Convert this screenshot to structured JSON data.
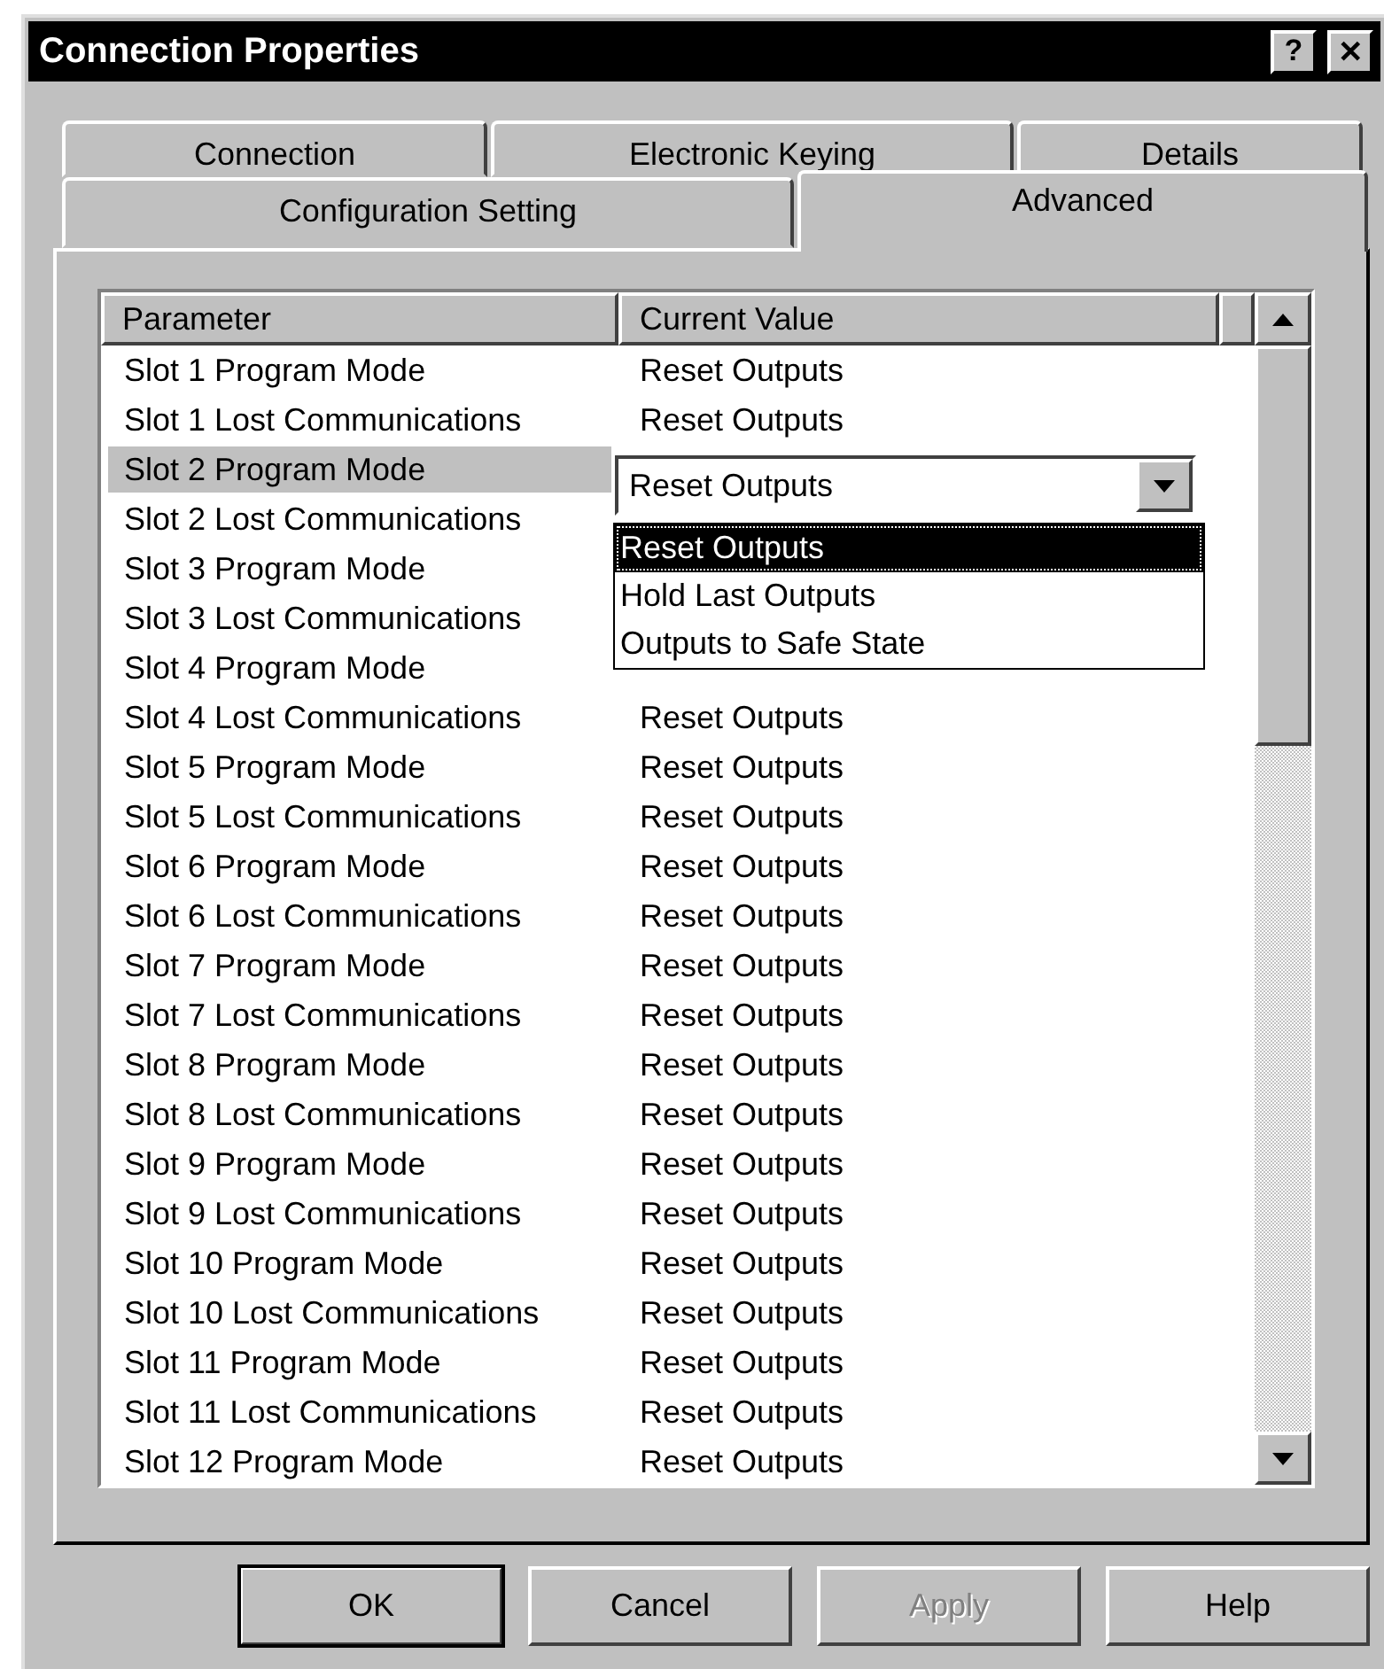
{
  "window": {
    "title": "Connection Properties",
    "help_button": "?",
    "close_button": "✕"
  },
  "tab_rows": [
    [
      {
        "label": "Connection",
        "selected": false
      },
      {
        "label": "Electronic Keying",
        "selected": false
      },
      {
        "label": "Details",
        "selected": false
      }
    ],
    [
      {
        "label": "Configuration Setting",
        "selected": false
      },
      {
        "label": "Advanced",
        "selected": true
      }
    ]
  ],
  "table": {
    "columns": [
      "Parameter",
      "Current Value"
    ],
    "rows": [
      {
        "parameter": "Slot 1 Program Mode",
        "value": "Reset Outputs",
        "selected": false
      },
      {
        "parameter": "Slot 1 Lost Communications",
        "value": "Reset Outputs",
        "selected": false
      },
      {
        "parameter": "Slot 2 Program Mode",
        "selected": true,
        "dropdown": {
          "value": "Reset Outputs",
          "expanded": true,
          "options": [
            {
              "label": "Reset Outputs",
              "selected": true
            },
            {
              "label": "Hold Last Outputs",
              "selected": false
            },
            {
              "label": "Outputs to Safe State",
              "selected": false
            }
          ]
        }
      },
      {
        "parameter": "Slot 2 Lost Communications",
        "selected": false
      },
      {
        "parameter": "Slot 3 Program Mode",
        "selected": false
      },
      {
        "parameter": "Slot 3 Lost Communications",
        "selected": false
      },
      {
        "parameter": "Slot 4 Program Mode",
        "selected": false
      },
      {
        "parameter": "Slot 4 Lost Communications",
        "value": "Reset Outputs",
        "selected": false
      },
      {
        "parameter": "Slot 5 Program Mode",
        "value": "Reset Outputs",
        "selected": false
      },
      {
        "parameter": "Slot 5 Lost Communications",
        "value": "Reset Outputs",
        "selected": false
      },
      {
        "parameter": "Slot 6 Program Mode",
        "value": "Reset Outputs",
        "selected": false
      },
      {
        "parameter": "Slot 6 Lost Communications",
        "value": "Reset Outputs",
        "selected": false
      },
      {
        "parameter": "Slot 7 Program Mode",
        "value": "Reset Outputs",
        "selected": false
      },
      {
        "parameter": "Slot 7 Lost Communications",
        "value": "Reset Outputs",
        "selected": false
      },
      {
        "parameter": "Slot 8 Program Mode",
        "value": "Reset Outputs",
        "selected": false
      },
      {
        "parameter": "Slot 8 Lost Communications",
        "value": "Reset Outputs",
        "selected": false
      },
      {
        "parameter": "Slot 9 Program Mode",
        "value": "Reset Outputs",
        "selected": false
      },
      {
        "parameter": "Slot 9 Lost Communications",
        "value": "Reset Outputs",
        "selected": false
      },
      {
        "parameter": "Slot 10 Program Mode",
        "value": "Reset Outputs",
        "selected": false
      },
      {
        "parameter": "Slot 10 Lost Communications",
        "value": "Reset Outputs",
        "selected": false
      },
      {
        "parameter": "Slot 11 Program Mode",
        "value": "Reset Outputs",
        "selected": false
      },
      {
        "parameter": "Slot 11 Lost Communications",
        "value": "Reset Outputs",
        "selected": false
      },
      {
        "parameter": "Slot 12 Program Mode",
        "value": "Reset Outputs",
        "selected": false
      }
    ]
  },
  "buttons": [
    {
      "label": "OK",
      "disabled": false,
      "default": true
    },
    {
      "label": "Cancel",
      "disabled": false,
      "default": false
    },
    {
      "label": "Apply",
      "disabled": true,
      "default": false
    },
    {
      "label": "Help",
      "disabled": false,
      "default": false
    }
  ]
}
